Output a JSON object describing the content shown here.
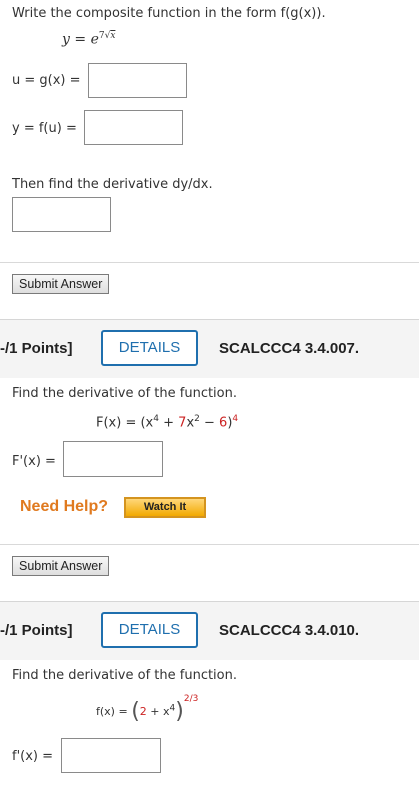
{
  "q1": {
    "instruction": "Write the composite function in the form f(g(x)).",
    "equation": {
      "lhs": "y",
      "eq": "=",
      "base": "e",
      "coef": "7",
      "radicand": "x"
    },
    "u_label": "u = g(x) =",
    "y_label": "y = f(u) =",
    "then_text": "Then find the derivative dy/dx.",
    "submit_label": "Submit Answer"
  },
  "q2": {
    "points": "-/1 Points]",
    "details_label": "DETAILS",
    "code": "SCALCCC4 3.4.007.",
    "instruction": "Find the derivative of the function.",
    "func": {
      "lhs": "F(x) = (x",
      "exp1": "4",
      "plus1": " + ",
      "term2": "7",
      "term2b": "x",
      "exp2": "2",
      "minus": " − ",
      "term3": "6",
      "close": ")",
      "outer_exp": "4"
    },
    "answer_label": "F'(x) =",
    "need_help": "Need Help?",
    "watch_label": "Watch It",
    "submit_label": "Submit Answer"
  },
  "q3": {
    "points": "-/1 Points]",
    "details_label": "DETAILS",
    "code": "SCALCCC4 3.4.010.",
    "instruction": "Find the derivative of the function.",
    "func": {
      "lhs": "f(x) =",
      "open": "(",
      "term1": "2",
      "plus": " + x",
      "exp": "4",
      "close": ")",
      "outer_exp": "2/3"
    },
    "answer_label": "f'(x) ="
  },
  "colors": {
    "accent": "#1f6fae",
    "help": "#e07a1f",
    "highlight_red": "#cc2222"
  }
}
